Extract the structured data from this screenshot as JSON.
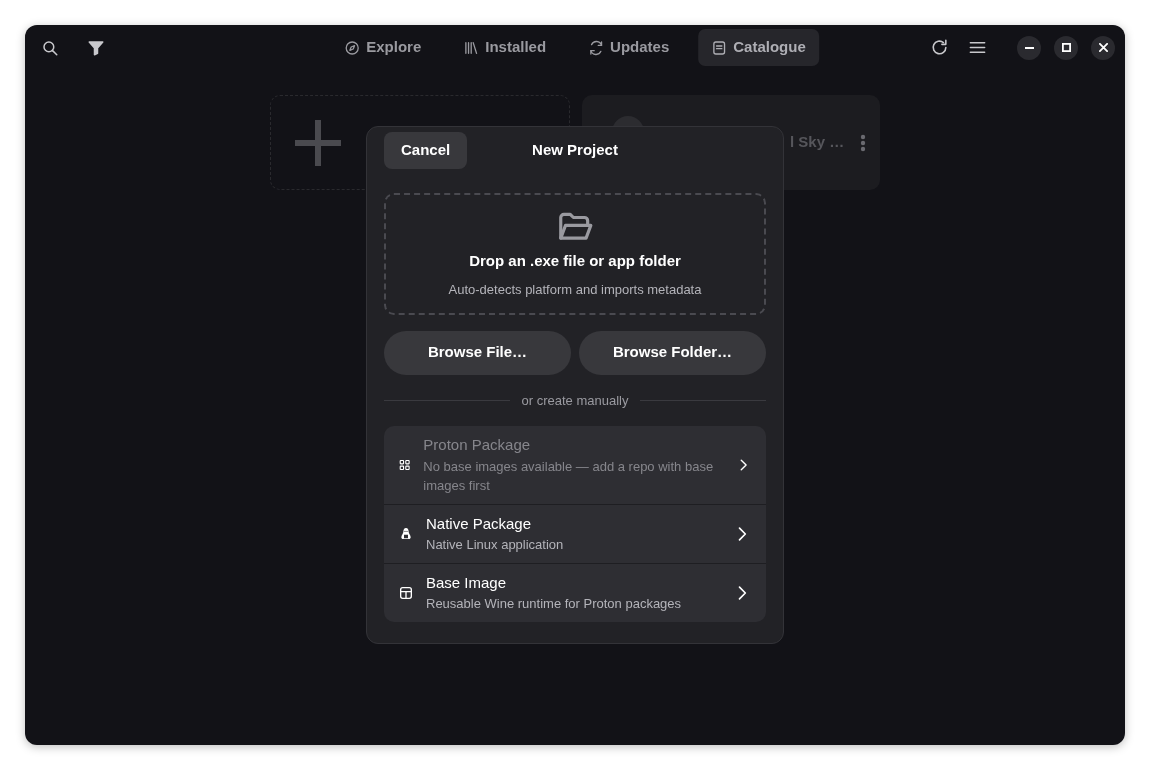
{
  "header": {
    "tabs": [
      {
        "label": "Explore",
        "kind": "explore",
        "selected": false
      },
      {
        "label": "Installed",
        "kind": "installed",
        "selected": false
      },
      {
        "label": "Updates",
        "kind": "updates",
        "selected": false
      },
      {
        "label": "Catalogue",
        "kind": "catalogue",
        "selected": true
      }
    ]
  },
  "background": {
    "project_card": {
      "title": "l Sky …"
    }
  },
  "dialog": {
    "title": "New Project",
    "cancel": "Cancel",
    "drop_zone": {
      "title": "Drop an .exe file or app folder",
      "subtitle": "Auto-detects platform and imports metadata"
    },
    "buttons": [
      "Browse File…",
      "Browse Folder…"
    ],
    "divider": "or create manually",
    "options": [
      {
        "kind": "proton",
        "title": "Proton Package",
        "subtitle": "No base images available — add a repo with base images first",
        "disabled": true
      },
      {
        "kind": "native",
        "title": "Native Package",
        "subtitle": "Native Linux application",
        "disabled": false
      },
      {
        "kind": "base",
        "title": "Base Image",
        "subtitle": "Reusable Wine runtime for Proton packages",
        "disabled": false
      }
    ]
  }
}
